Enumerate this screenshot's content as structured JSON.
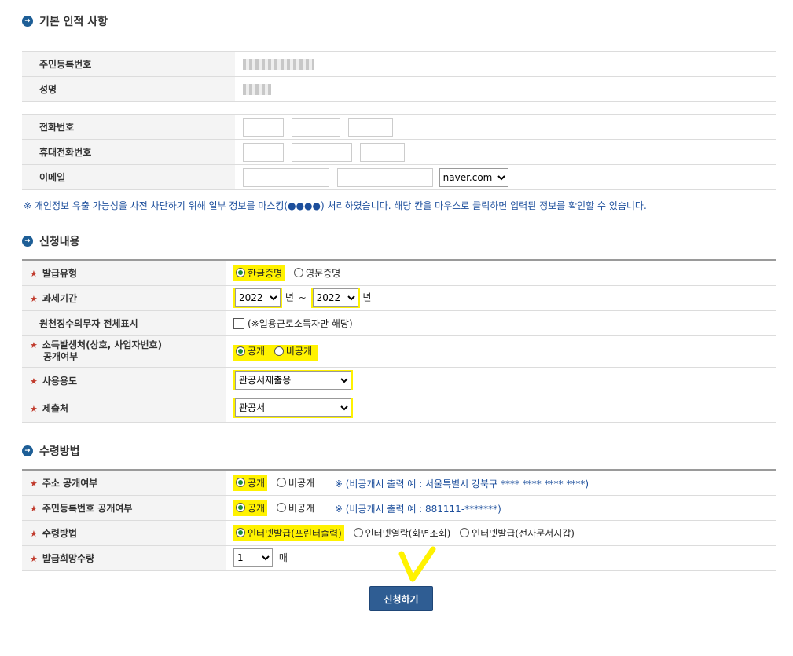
{
  "section1": {
    "title": "기본 인적 사항",
    "rows": [
      {
        "label": "주민등록번호"
      },
      {
        "label": "성명"
      },
      {
        "label": "전화번호"
      },
      {
        "label": "휴대전화번호"
      },
      {
        "label": "이메일",
        "domain": "naver.com"
      }
    ],
    "notice": "※ 개인정보 유출 가능성을 사전 차단하기 위해 일부 정보를 마스킹(●●●●) 처리하였습니다. 해당 칸을 마우스로 클릭하면 입력된 정보를 확인할 수 있습니다."
  },
  "section2": {
    "title": "신청내용",
    "issue_type": {
      "label": "발급유형",
      "opt1": "한글증명",
      "opt2": "영문증명"
    },
    "tax_period": {
      "label": "과세기간",
      "from": "2022",
      "to": "2022",
      "year": "년",
      "tilde": "~"
    },
    "withhold": {
      "label": "원천징수의무자 전체표시",
      "text": "(※일용근로소득자만 해당)"
    },
    "income_source": {
      "label_line1": "소득발생처(상호, 사업자번호)",
      "label_line2": "공개여부",
      "opt1": "공개",
      "opt2": "비공개"
    },
    "usage": {
      "label": "사용용도",
      "value": "관공서제출용"
    },
    "submit_to": {
      "label": "제출처",
      "value": "관공서"
    }
  },
  "section3": {
    "title": "수령방법",
    "address": {
      "label": "주소 공개여부",
      "opt1": "공개",
      "opt2": "비공개",
      "note": "※ (비공개시 출력 예 : 서울특별시 강북구 **** **** **** ****)"
    },
    "rrn": {
      "label": "주민등록번호 공개여부",
      "opt1": "공개",
      "opt2": "비공개",
      "note": "※ (비공개시 출력 예 : 881111-*******)"
    },
    "method": {
      "label": "수령방법",
      "opt1": "인터넷발급(프린터출력)",
      "opt2": "인터넷열람(화면조회)",
      "opt3": "인터넷발급(전자문서지갑)"
    },
    "quantity": {
      "label": "발급희망수량",
      "value": "1",
      "unit": "매"
    }
  },
  "submit_label": "신청하기",
  "colors": {
    "accent": "#2f5d93",
    "highlight": "#fff200",
    "required": "#c0392b",
    "note": "#1d4f9c"
  }
}
